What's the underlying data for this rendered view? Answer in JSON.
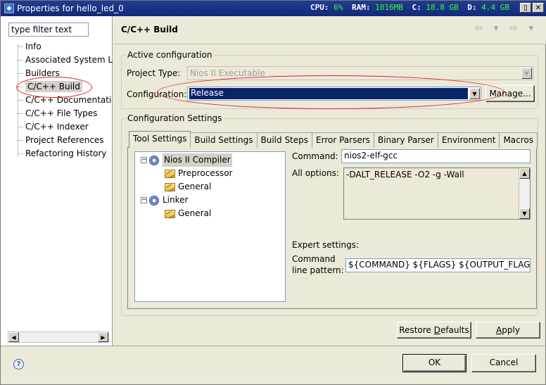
{
  "window": {
    "title": "Properties for hello_led_0",
    "icon": "eclipse-window-icon",
    "sysmon": [
      {
        "label": "CPU:",
        "value": "6%"
      },
      {
        "label": "RAM:",
        "value": "1016MB"
      },
      {
        "label": "C:",
        "value": "18.8 GB"
      },
      {
        "label": "D:",
        "value": "4.4 GB"
      }
    ],
    "controls": [
      "▯",
      "✕"
    ]
  },
  "sidebar": {
    "filter_placeholder": "type filter text",
    "items": [
      {
        "label": "Info"
      },
      {
        "label": "Associated System L"
      },
      {
        "label": "Builders"
      },
      {
        "label": "C/C++ Build",
        "selected": true
      },
      {
        "label": "C/C++ Documentati"
      },
      {
        "label": "C/C++ File Types"
      },
      {
        "label": "C/C++ Indexer"
      },
      {
        "label": "Project References"
      },
      {
        "label": "Refactoring History"
      }
    ]
  },
  "header": {
    "title": "C/C++ Build",
    "nav": "⇦ ▾ ⇨ ▾"
  },
  "active_config": {
    "legend": "Active configuration",
    "project_type_label": "Project Type:",
    "project_type_value": "Nios II Executable",
    "configuration_label": "Configuration:",
    "configuration_value": "Release",
    "manage_label": "Manage..."
  },
  "config_settings": {
    "legend": "Configuration Settings",
    "tabs": [
      {
        "label": "Tool Settings",
        "active": true
      },
      {
        "label": "Build Settings"
      },
      {
        "label": "Build Steps"
      },
      {
        "label": "Error Parsers"
      },
      {
        "label": "Binary Parser"
      },
      {
        "label": "Environment"
      },
      {
        "label": "Macros"
      }
    ],
    "tool_tree": [
      {
        "label": "Nios II Compiler",
        "level": 0,
        "kind": "tool",
        "selected": true
      },
      {
        "label": "Preprocessor",
        "level": 1,
        "kind": "folder"
      },
      {
        "label": "General",
        "level": 1,
        "kind": "folder"
      },
      {
        "label": "Linker",
        "level": 0,
        "kind": "tool"
      },
      {
        "label": "General",
        "level": 1,
        "kind": "folder"
      }
    ],
    "command_label": "Command:",
    "command_value": "nios2-elf-gcc",
    "all_options_label": "All options:",
    "all_options_value": "-DALT_RELEASE -O2 -g -Wall",
    "expert_label": "Expert settings:",
    "cmd_line_label_1": "Command",
    "cmd_line_label_2": "line pattern:",
    "cmd_line_value": "${COMMAND} ${FLAGS} ${OUTPUT_FLAG}${"
  },
  "buttons": {
    "restore_defaults_pre": "Restore ",
    "restore_defaults_u": "D",
    "restore_defaults_post": "efaults",
    "apply_pre": "",
    "apply_u": "A",
    "apply_post": "pply",
    "ok": "OK",
    "cancel": "Cancel"
  },
  "annotation_color": "#e02020"
}
